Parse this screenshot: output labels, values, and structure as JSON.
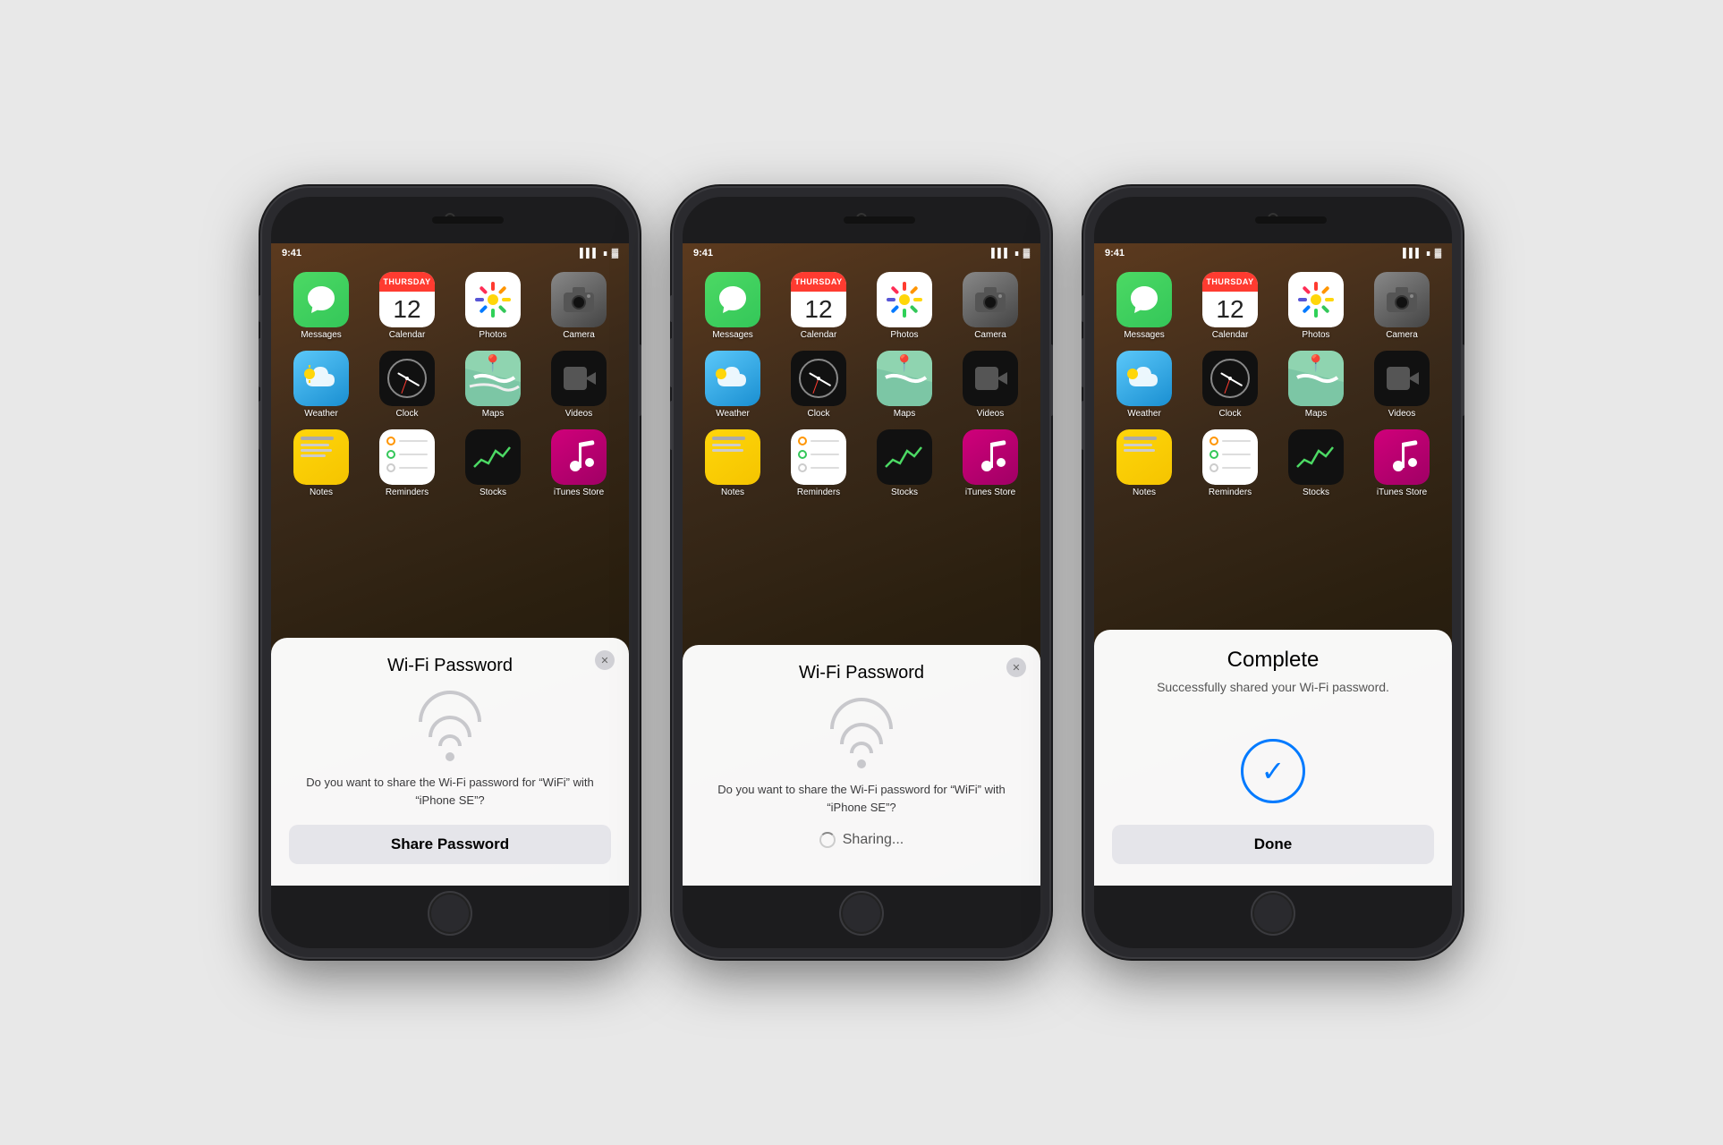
{
  "phones": [
    {
      "id": "phone-1",
      "modal": "share-request",
      "modal_title": "Wi-Fi Password",
      "modal_body": "Do you want to share the Wi-Fi password for “WiFi” with “iPhone SE”?",
      "btn_label": "Share Password",
      "close_btn": "✕"
    },
    {
      "id": "phone-2",
      "modal": "sharing",
      "modal_title": "Wi-Fi Password",
      "modal_body": "Do you want to share the Wi-Fi password for “WiFi” with “iPhone SE”?",
      "sharing_text": "Sharing...",
      "close_btn": "✕"
    },
    {
      "id": "phone-3",
      "modal": "complete",
      "complete_title": "Complete",
      "complete_subtitle": "Successfully shared your Wi-Fi password.",
      "btn_label": "Done"
    }
  ],
  "homescreen": {
    "apps": [
      {
        "id": "messages",
        "label": "Messages"
      },
      {
        "id": "calendar",
        "label": "Calendar",
        "day": "12",
        "day_name": "Thursday"
      },
      {
        "id": "photos",
        "label": "Photos"
      },
      {
        "id": "camera",
        "label": "Camera"
      },
      {
        "id": "weather",
        "label": "Weather"
      },
      {
        "id": "clock",
        "label": "Clock"
      },
      {
        "id": "maps",
        "label": "Maps"
      },
      {
        "id": "videos",
        "label": "Videos"
      },
      {
        "id": "notes",
        "label": "Notes"
      },
      {
        "id": "reminders",
        "label": "Reminders"
      },
      {
        "id": "stocks",
        "label": "Stocks"
      },
      {
        "id": "itunes",
        "label": "iTunes Store"
      }
    ]
  }
}
